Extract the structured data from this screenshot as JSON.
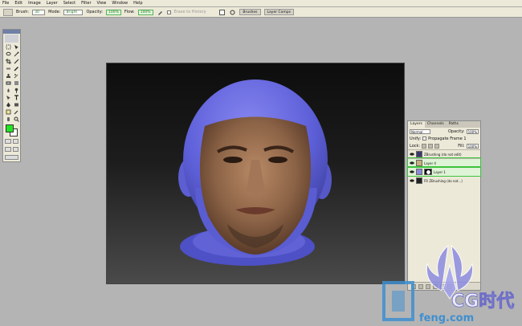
{
  "menu": [
    "File",
    "Edit",
    "Image",
    "Layer",
    "Select",
    "Filter",
    "View",
    "Window",
    "Help"
  ],
  "options": {
    "brush_label": "Brush:",
    "brush_size": "30",
    "mode_label": "Mode:",
    "mode_value": "Bright",
    "opacity_label": "Opacity:",
    "opacity_value": "100%",
    "flow_label": "Flow:",
    "flow_value": "100%",
    "erase_label": "Erase to History"
  },
  "palette_well": {
    "tab1": "Brushes",
    "tab2": "Layer Comps"
  },
  "toolbox": {
    "foreground_color": "#22e622",
    "background_color": "#ffffff"
  },
  "layers": {
    "tabs": [
      "Layers",
      "Channels",
      "Paths"
    ],
    "blend_mode": "Normal",
    "opacity_label": "Opacity:",
    "opacity_value": "100%",
    "lock_label": "Lock:",
    "fill_label": "Fill:",
    "fill_value": "100%",
    "propagate_label": "Propagate Frame 1",
    "unify_label": "Unify:",
    "items": [
      {
        "name": "ZBrushing (do not edit)",
        "selected": false,
        "thumb": "#3a3a6a"
      },
      {
        "name": "Layer 4",
        "selected": true,
        "thumb": "#c8b07c"
      },
      {
        "name": "Layer 1",
        "selected": true,
        "thumb": "#8a8ad8"
      },
      {
        "name": "FR ZBrushing (do not...)",
        "selected": false,
        "thumb": "#222"
      }
    ]
  },
  "watermark": {
    "brand": "CG时代",
    "url": "feng.com"
  },
  "colors": {
    "head_blue": "#6666e6",
    "accent_green": "#3cc43c"
  }
}
